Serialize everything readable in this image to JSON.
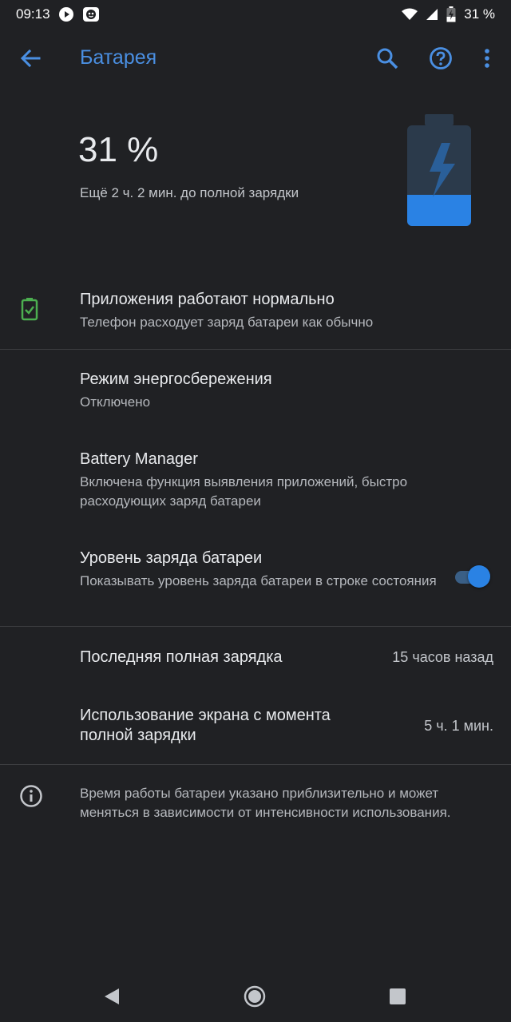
{
  "status_bar": {
    "time": "09:13",
    "battery_text": "31 %",
    "icons_left": [
      "play-icon",
      "notification-face-icon"
    ],
    "icons_right": [
      "wifi-icon",
      "cell-signal-icon",
      "battery-charging-icon"
    ]
  },
  "app_bar": {
    "title": "Батарея",
    "accent_color": "#4a8fe2"
  },
  "battery_header": {
    "percent": "31 %",
    "time_to_full": "Ещё 2 ч. 2 мин. до полной зарядки",
    "level": 0.31,
    "fill_color": "#2a82e4"
  },
  "apps_status": {
    "title": "Приложения работают нормально",
    "subtitle": "Телефон расходует заряд батареи как обычно",
    "icon": "battery-ok-icon"
  },
  "saver": {
    "title": "Режим энергосбережения",
    "subtitle": "Отключено"
  },
  "manager": {
    "title": "Battery Manager",
    "subtitle": "Включена функция выявления приложений, быстро расходующих заряд батареи"
  },
  "level_indicator": {
    "title": "Уровень заряда батареи",
    "subtitle": "Показывать уровень заряда батареи в строке состояния",
    "enabled": true
  },
  "last_charge": {
    "title": "Последняя полная зарядка",
    "value": "15 часов назад"
  },
  "screen_usage": {
    "title": "Использование экрана с момента полной зарядки",
    "value": "5 ч. 1 мин."
  },
  "info": {
    "text": "Время работы батареи указано приблизительно и может меняться в зависимости от интенсивности использования."
  }
}
